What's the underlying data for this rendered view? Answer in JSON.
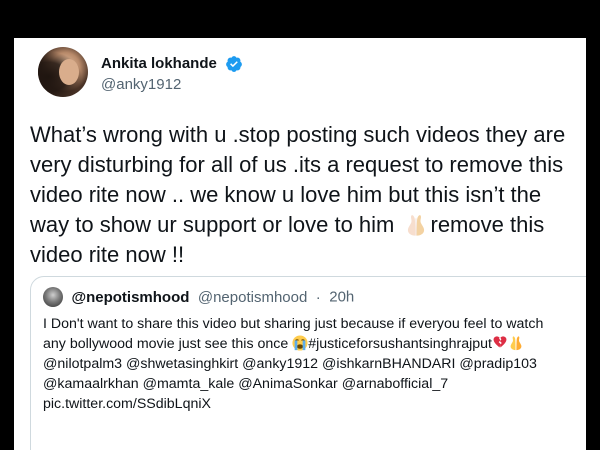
{
  "tweet": {
    "author": {
      "display_name": "Ankita lokhande",
      "handle": "@anky1912",
      "verified": true
    },
    "text_part1": "What’s wrong with u .stop posting such videos they are\nvery disturbing for all of us .its a request to remove this\nvideo rite now .. we know u love him but this isn’t the\nway to show ur support or love to him ",
    "emoji_1": "folded-hands",
    "text_part2": "remove this\nvideo rite now !!"
  },
  "quoted_tweet": {
    "author": {
      "display_name": "@nepotismhood",
      "handle": "@nepotismhood",
      "separator": "·",
      "time": "20h"
    },
    "text_part1": "I Don't want to share this video but sharing just because if everyou feel to watch\nany bollywood movie just see this once ",
    "emoji_crying": "loudly-crying-face",
    "text_part2": "#justiceforsushantsinghrajput",
    "emoji_broken_heart": "broken-heart",
    "emoji_pray": "folded-hands",
    "text_part3": "\n@nilotpalm3 @shwetasinghkirt @anky1912 @ishkarnBHANDARI @pradip103\n@kamaalrkhan @mamta_kale @AnimaSonkar @arnabofficial_7\npic.twitter.com/SSdibLqniX"
  },
  "colors": {
    "background": "#000000",
    "card": "#ffffff",
    "text_primary": "#0f1419",
    "text_secondary": "#536471",
    "verified_blue": "#1d9bf0",
    "border": "#cfd9de"
  }
}
